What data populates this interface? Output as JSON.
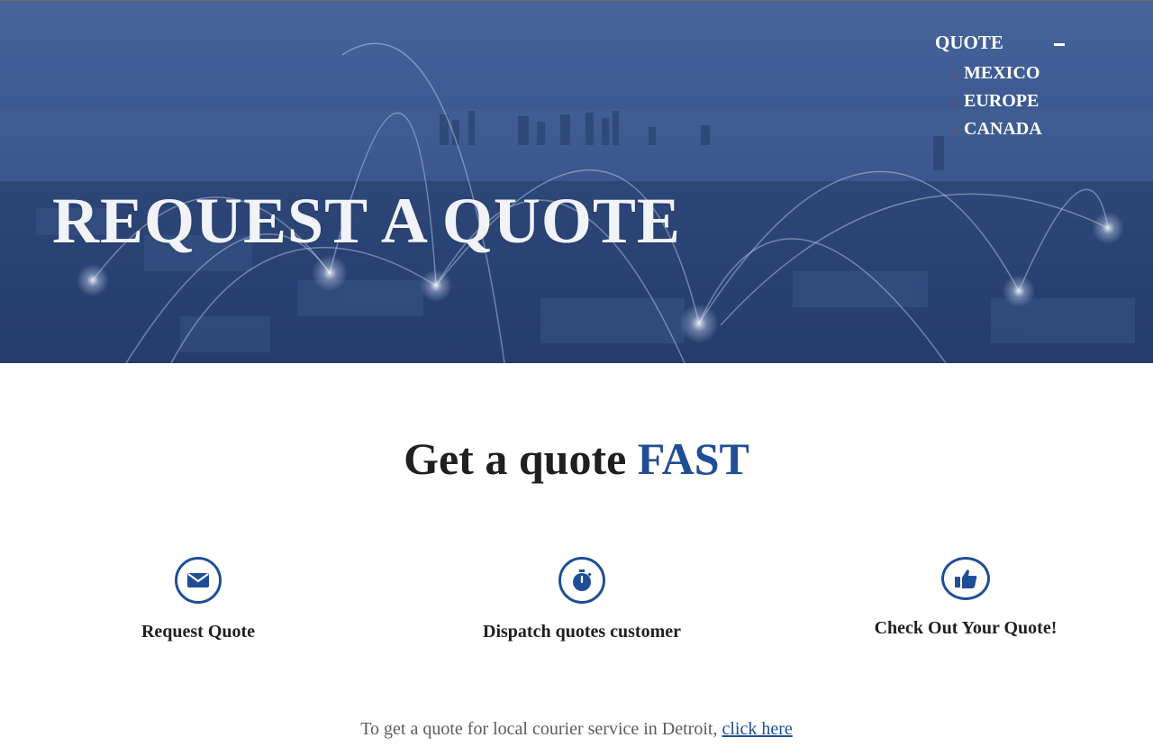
{
  "hero": {
    "title": "REQUEST A QUOTE"
  },
  "nav": {
    "dropdown_label": "QUOTE",
    "items": [
      {
        "label": "MEXICO"
      },
      {
        "label": "EUROPE"
      },
      {
        "label": "CANADA"
      }
    ]
  },
  "intro": {
    "heading": "Get a quote ",
    "heading_accent": "FAST"
  },
  "features": [
    {
      "label": "Request Quote",
      "icon": "envelope-icon"
    },
    {
      "label": "Dispatch quotes customer",
      "icon": "stopwatch-icon"
    },
    {
      "label": "Check Out Your Quote!",
      "icon": "thumbs-up-icon"
    }
  ],
  "footer": {
    "text": "To get a quote for local courier service in Detroit,",
    "link": "click here"
  },
  "colors": {
    "accent": "#1f4e96",
    "hero_blue": "#3c5a92",
    "chevron_red": "#c8282a"
  }
}
